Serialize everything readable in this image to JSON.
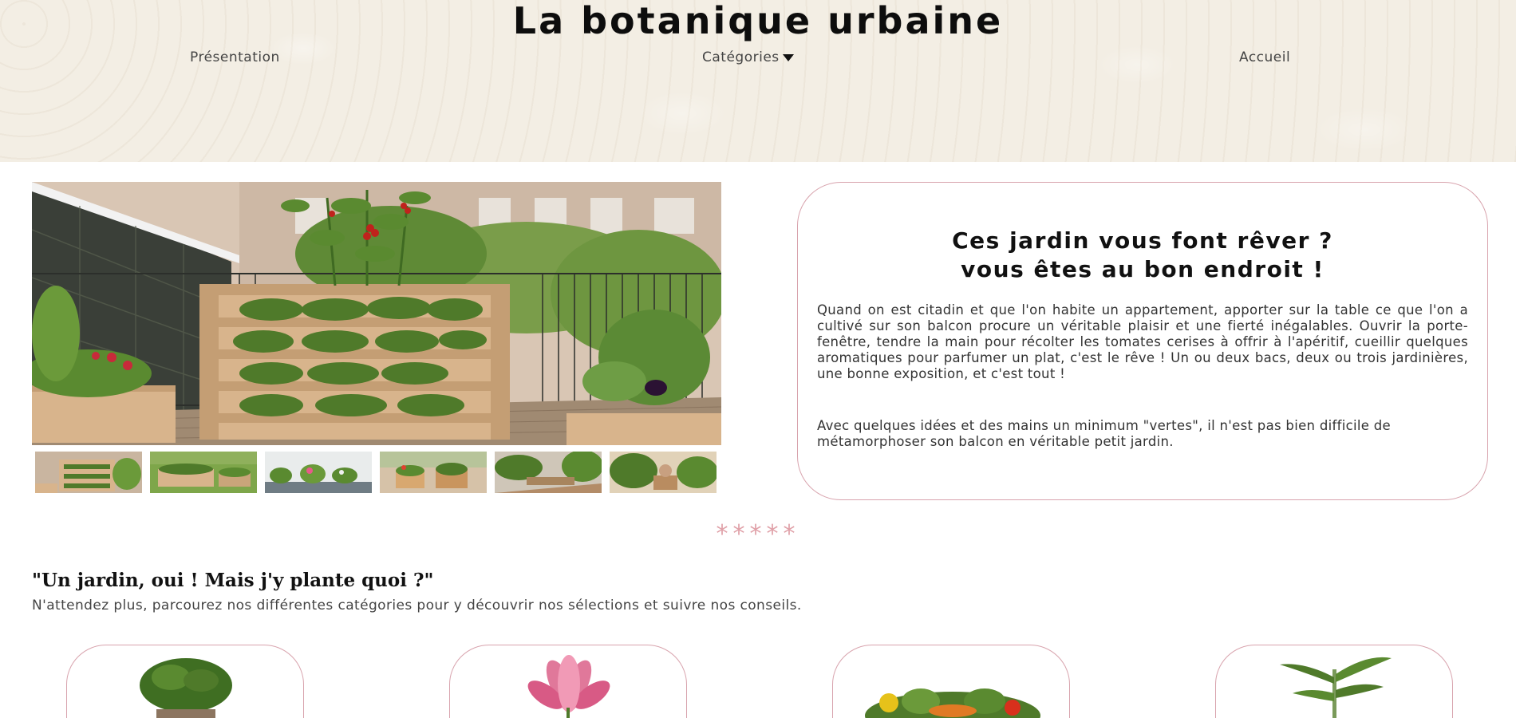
{
  "header": {
    "title": "La botanique urbaine",
    "nav": [
      {
        "label": "Présentation"
      },
      {
        "label": "Catégories"
      },
      {
        "label": "Accueil"
      }
    ]
  },
  "gallery": {
    "main_image": "balcony-vertical-garden",
    "thumbnails": [
      "vertical-planter",
      "raised-beds-lawn",
      "flower-pots-balcony",
      "terrace-planters",
      "long-balcony-garden",
      "patio-garden"
    ]
  },
  "intro": {
    "heading_line1": "Ces jardin vous font rêver ?",
    "heading_line2": "vous êtes au bon endroit !",
    "paragraph1": "Quand on est citadin et que l'on habite un appartement, apporter sur la table ce que l'on a cultivé sur son balcon procure un véritable plaisir et une fierté inégalables. Ouvrir la porte-fenêtre, tendre la main pour récolter les tomates cerises à offrir à l'apéritif, cueillir quelques aromatiques pour parfumer un plat, c'est le rêve ! Un ou deux bacs, deux ou trois jardinières, une bonne exposition, et c'est tout !",
    "paragraph2": "Avec quelques idées et des mains un minimum \"vertes\", il n'est pas bien difficile de métamorphoser son balcon en véritable petit jardin."
  },
  "divider": "*****",
  "categories_section": {
    "title": "\"Un jardin, oui ! Mais j'y plante quoi ?\"",
    "subtitle": "N'attendez plus, parcourez nos différentes catégories pour y découvrir nos sélections et suivre nos conseils."
  },
  "category_cards": [
    {
      "icon": "boxwood-topiary-icon"
    },
    {
      "icon": "lotus-flower-icon"
    },
    {
      "icon": "vegetables-icon"
    },
    {
      "icon": "bamboo-plant-icon"
    }
  ],
  "colors": {
    "header_bg": "#f3eee4",
    "card_border": "#d8a3ad",
    "stars": "#e0a0a8"
  }
}
